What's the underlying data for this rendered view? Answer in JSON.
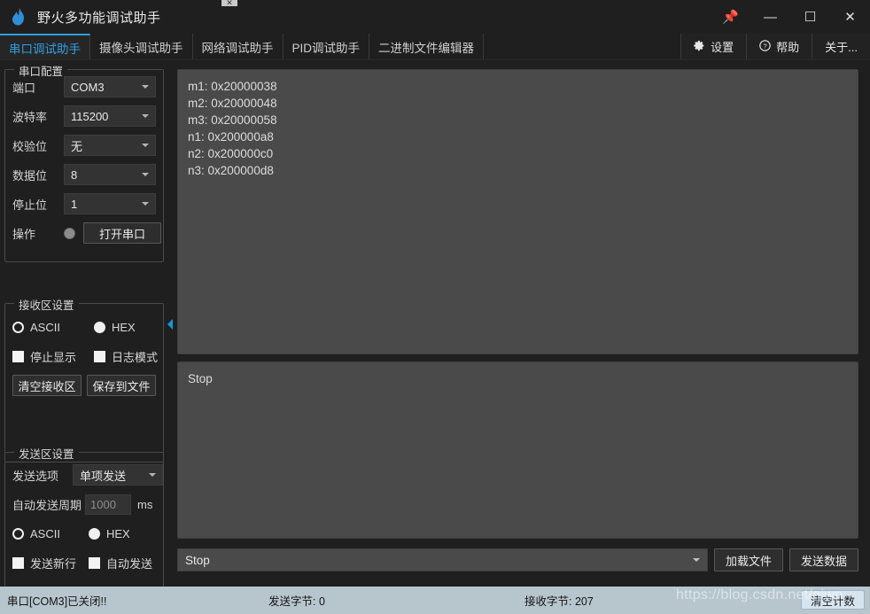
{
  "window": {
    "title": "野火多功能调试助手",
    "logo_icon": "flame-icon",
    "controls": {
      "pin": "📌",
      "minimize": "—",
      "maximize": "☐",
      "close": "✕"
    }
  },
  "tabs": [
    {
      "label": "串口调试助手",
      "active": true
    },
    {
      "label": "摄像头调试助手",
      "active": false
    },
    {
      "label": "网络调试助手",
      "active": false
    },
    {
      "label": "PID调试助手",
      "active": false
    },
    {
      "label": "二进制文件编辑器",
      "active": false
    }
  ],
  "toolbar": [
    {
      "label": "设置",
      "icon": "gear-icon"
    },
    {
      "label": "帮助",
      "icon": "question-circle-icon"
    },
    {
      "label": "关于...",
      "icon": ""
    }
  ],
  "serial_config": {
    "group_title": "串口配置",
    "port": {
      "label": "端口",
      "value": "COM3"
    },
    "baud": {
      "label": "波特率",
      "value": "115200"
    },
    "parity": {
      "label": "校验位",
      "value": "无"
    },
    "databits": {
      "label": "数据位",
      "value": "8"
    },
    "stopbits": {
      "label": "停止位",
      "value": "1"
    },
    "operation": {
      "label": "操作",
      "button": "打开串口",
      "led_state": "off"
    }
  },
  "recv_settings": {
    "group_title": "接收区设置",
    "ascii": "ASCII",
    "hex": "HEX",
    "format_selected": "ASCII",
    "stop_display": "停止显示",
    "log_mode": "日志模式",
    "clear_btn": "清空接收区",
    "save_btn": "保存到文件"
  },
  "send_settings": {
    "group_title": "发送区设置",
    "send_option_label": "发送选项",
    "send_option_value": "单项发送",
    "auto_period_label": "自动发送周期",
    "auto_period_value": "1000",
    "auto_period_unit": "ms",
    "ascii": "ASCII",
    "hex": "HEX",
    "format_selected": "ASCII",
    "send_newline": "发送新行",
    "auto_send": "自动发送"
  },
  "receive_area": {
    "content": "m1: 0x20000038\nm2: 0x20000048\nm3: 0x20000058\nn1: 0x200000a8\nn2: 0x200000c0\nn3: 0x200000d8"
  },
  "send_area": {
    "content": "Stop"
  },
  "send_row": {
    "combo_value": "Stop",
    "load_file_btn": "加载文件",
    "send_data_btn": "发送数据"
  },
  "statusbar": {
    "port_status": "串口[COM3]已关闭!!",
    "sent_bytes": "发送字节: 0",
    "recv_bytes": "接收字节: 207",
    "clear_count_btn": "清空计数"
  },
  "watermark": "https://blog.csdn.net/qiwn",
  "colors": {
    "accent": "#2f9fe0",
    "splitter_arrow": "#0a9cdf",
    "window_bg": "#1f1f1f",
    "textarea_bg": "#4a4a4a",
    "statusbar_bg": "#b7c6cd"
  }
}
